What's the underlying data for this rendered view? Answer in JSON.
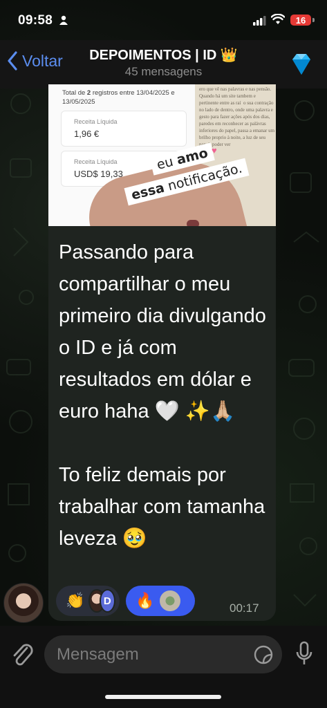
{
  "status_bar": {
    "time": "09:58",
    "battery": "16"
  },
  "header": {
    "back_label": "Voltar",
    "title": "DEPOIMENTOS | ID 👑",
    "subtitle": "45 mensagens"
  },
  "message": {
    "photo": {
      "summary_prefix": "Total de ",
      "summary_count": "2",
      "summary_rest": " registros entre 13/04/2025 e 13/05/2025",
      "revenue1_label": "Receita Líquida",
      "revenue1_value": "1,96 €",
      "revenue2_label": "Receita Líquida",
      "revenue2_value": "USD$ 19,33",
      "sticker_line1_a": "eu ",
      "sticker_line1_b": "amo",
      "sticker_line2_a": "essa",
      "sticker_line2_b": " notificação.",
      "book_text": "ero que vê nas palavras e nas pensão. Quando há um site tambem e pertinente entre as raí  o sua contração no lado de dentro, onde uma palavra e gesto para fazer ações após dos dias, paredes em reconhecer as palávras inferiores do papel, passa a emanar um brilho proprio à noite, a luz de seu papel: poder ver"
    },
    "text": "Passando para compartilhar o meu primeiro dia divulgando o ID e já com resultados em dólar e euro haha 🤍 ✨🙏🏼\n\nTo feliz demais por trabalhar com tamanha leveza 🥹",
    "reactions": [
      {
        "emoji": "👏",
        "avatar_letter": "D"
      },
      {
        "emoji": "🔥"
      }
    ],
    "time": "00:17"
  },
  "input": {
    "placeholder": "Mensagem"
  }
}
